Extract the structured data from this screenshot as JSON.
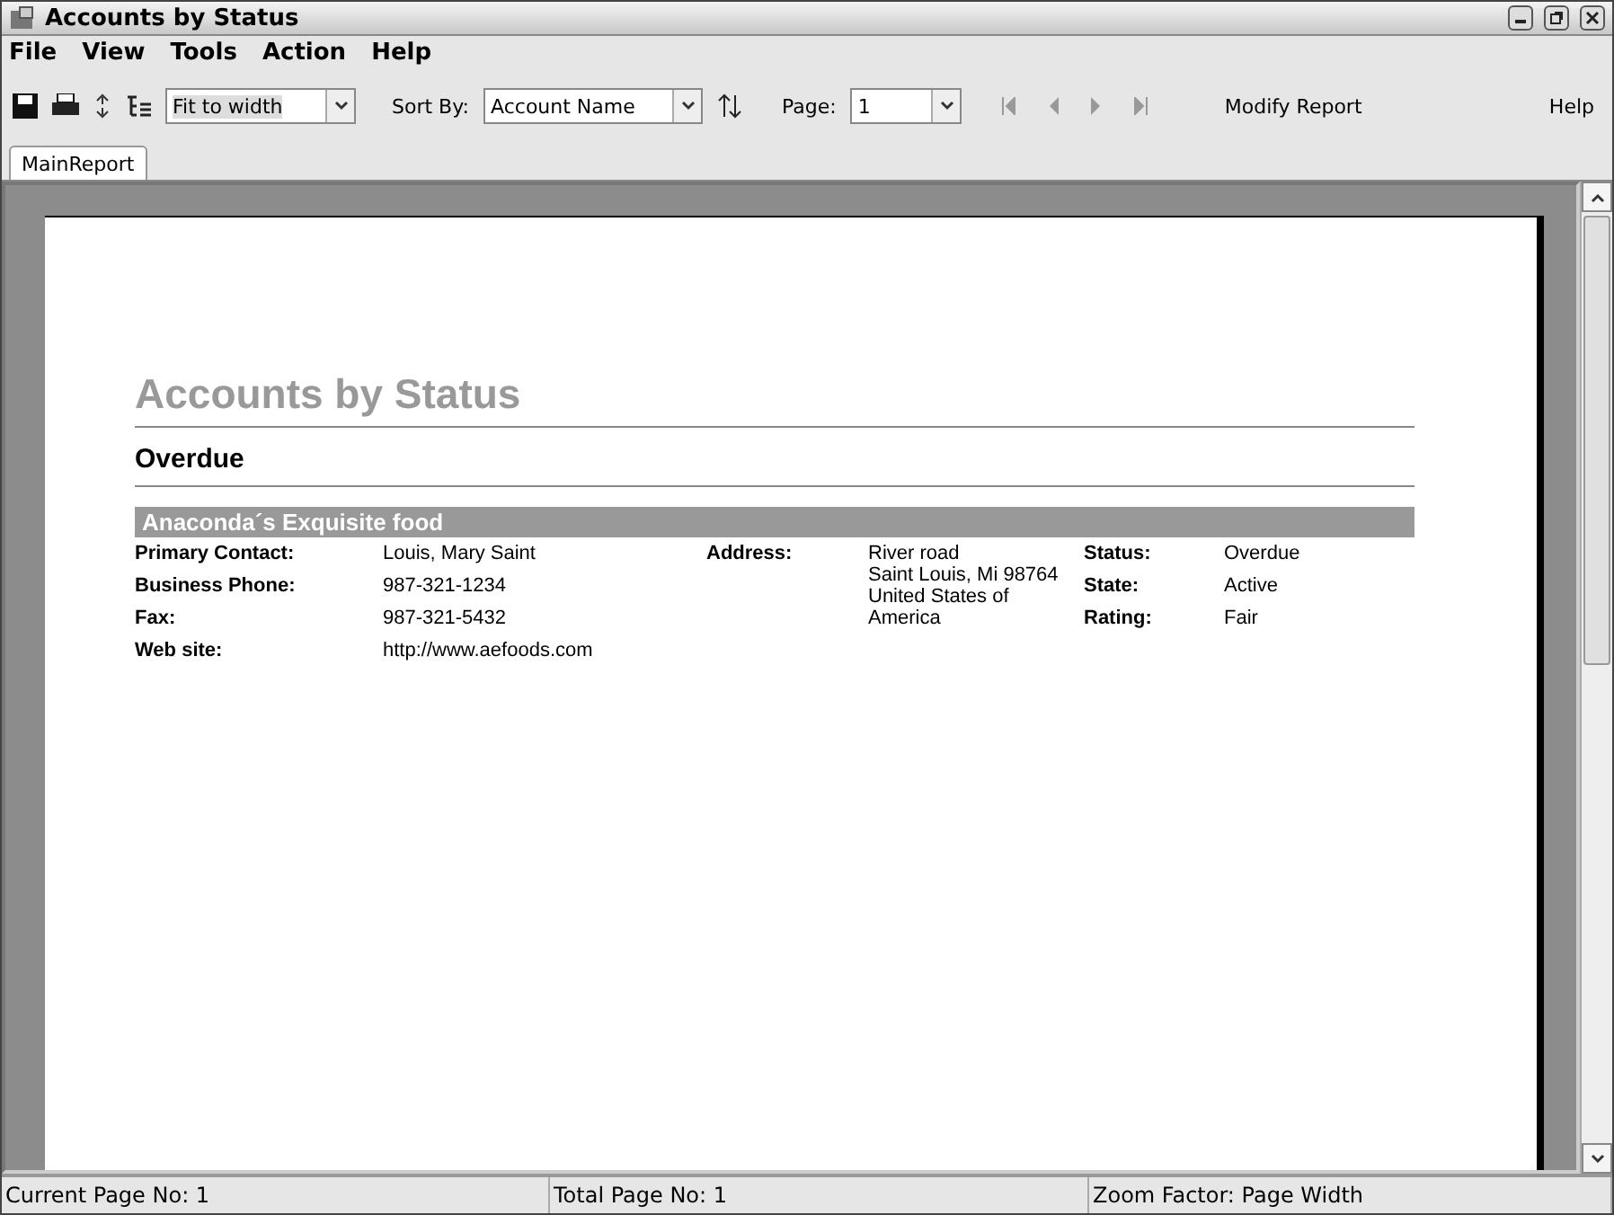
{
  "window": {
    "title": "Accounts by Status"
  },
  "menu": [
    "File",
    "View",
    "Tools",
    "Action",
    "Help"
  ],
  "toolbar": {
    "zoom": "Fit to width",
    "sort_label": "Sort By:",
    "sort_value": "Account Name",
    "page_label": "Page:",
    "page_value": "1",
    "modify": "Modify Report",
    "help": "Help"
  },
  "tabs": [
    {
      "label": "MainReport",
      "selected": true
    }
  ],
  "report": {
    "title": "Accounts by Status",
    "group": "Overdue",
    "account": "Anaconda´s Exquisite food",
    "col1": [
      {
        "label": "Primary Contact:",
        "value": "Louis, Mary Saint"
      },
      {
        "label": "Business Phone:",
        "value": "987-321-1234"
      },
      {
        "label": "Fax:",
        "value": "987-321-5432"
      },
      {
        "label": "Web site:",
        "value": "http://www.aefoods.com"
      }
    ],
    "address_label": "Address:",
    "address": [
      "River road",
      "Saint Louis, Mi  98764",
      "United States of America"
    ],
    "col3": [
      {
        "label": "Status:",
        "value": "Overdue"
      },
      {
        "label": "State:",
        "value": "Active"
      },
      {
        "label": "Rating:",
        "value": "Fair"
      }
    ]
  },
  "status_bar": [
    "Current Page No: 1",
    "Total Page No: 1",
    "Zoom Factor: Page Width"
  ]
}
